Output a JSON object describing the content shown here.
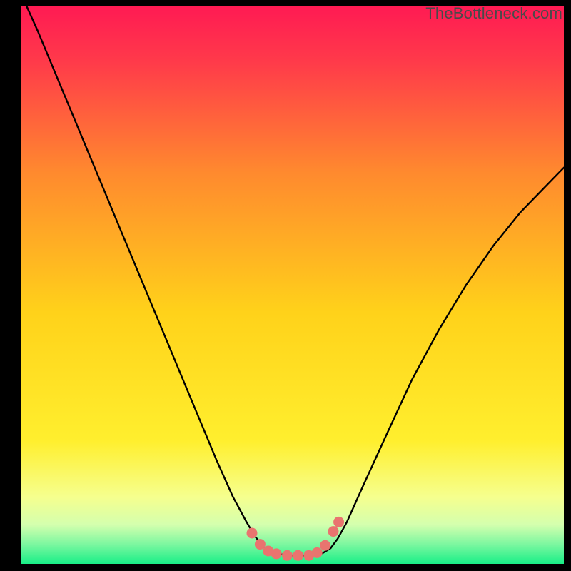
{
  "watermark": "TheBottleneck.com",
  "colors": {
    "frame": "#000000",
    "gradient_top": "#ff1a53",
    "gradient_mid": "#ffe10a",
    "gradient_low": "#f8ffb0",
    "gradient_bottom": "#19ef87",
    "curve": "#000000",
    "marker": "#e9746f"
  },
  "chart_data": {
    "type": "line",
    "title": "",
    "xlabel": "",
    "ylabel": "",
    "xlim": [
      0,
      1
    ],
    "ylim": [
      0,
      1
    ],
    "series": [
      {
        "name": "bottleneck-curve",
        "x": [
          0.0,
          0.03,
          0.06,
          0.09,
          0.12,
          0.15,
          0.18,
          0.21,
          0.24,
          0.27,
          0.3,
          0.33,
          0.36,
          0.39,
          0.415,
          0.43,
          0.445,
          0.455,
          0.47,
          0.5,
          0.53,
          0.555,
          0.57,
          0.583,
          0.6,
          0.63,
          0.67,
          0.72,
          0.77,
          0.82,
          0.87,
          0.92,
          0.97,
          1.0
        ],
        "y": [
          1.02,
          0.955,
          0.885,
          0.815,
          0.745,
          0.675,
          0.605,
          0.535,
          0.465,
          0.395,
          0.325,
          0.255,
          0.185,
          0.12,
          0.075,
          0.05,
          0.032,
          0.024,
          0.018,
          0.015,
          0.015,
          0.019,
          0.028,
          0.045,
          0.075,
          0.14,
          0.225,
          0.33,
          0.42,
          0.5,
          0.57,
          0.63,
          0.68,
          0.71
        ]
      }
    ],
    "markers": {
      "name": "highlight-dots",
      "x": [
        0.425,
        0.44,
        0.455,
        0.47,
        0.49,
        0.51,
        0.53,
        0.545,
        0.56,
        0.575,
        0.585
      ],
      "y": [
        0.055,
        0.035,
        0.023,
        0.018,
        0.015,
        0.015,
        0.015,
        0.02,
        0.033,
        0.058,
        0.075
      ]
    }
  }
}
